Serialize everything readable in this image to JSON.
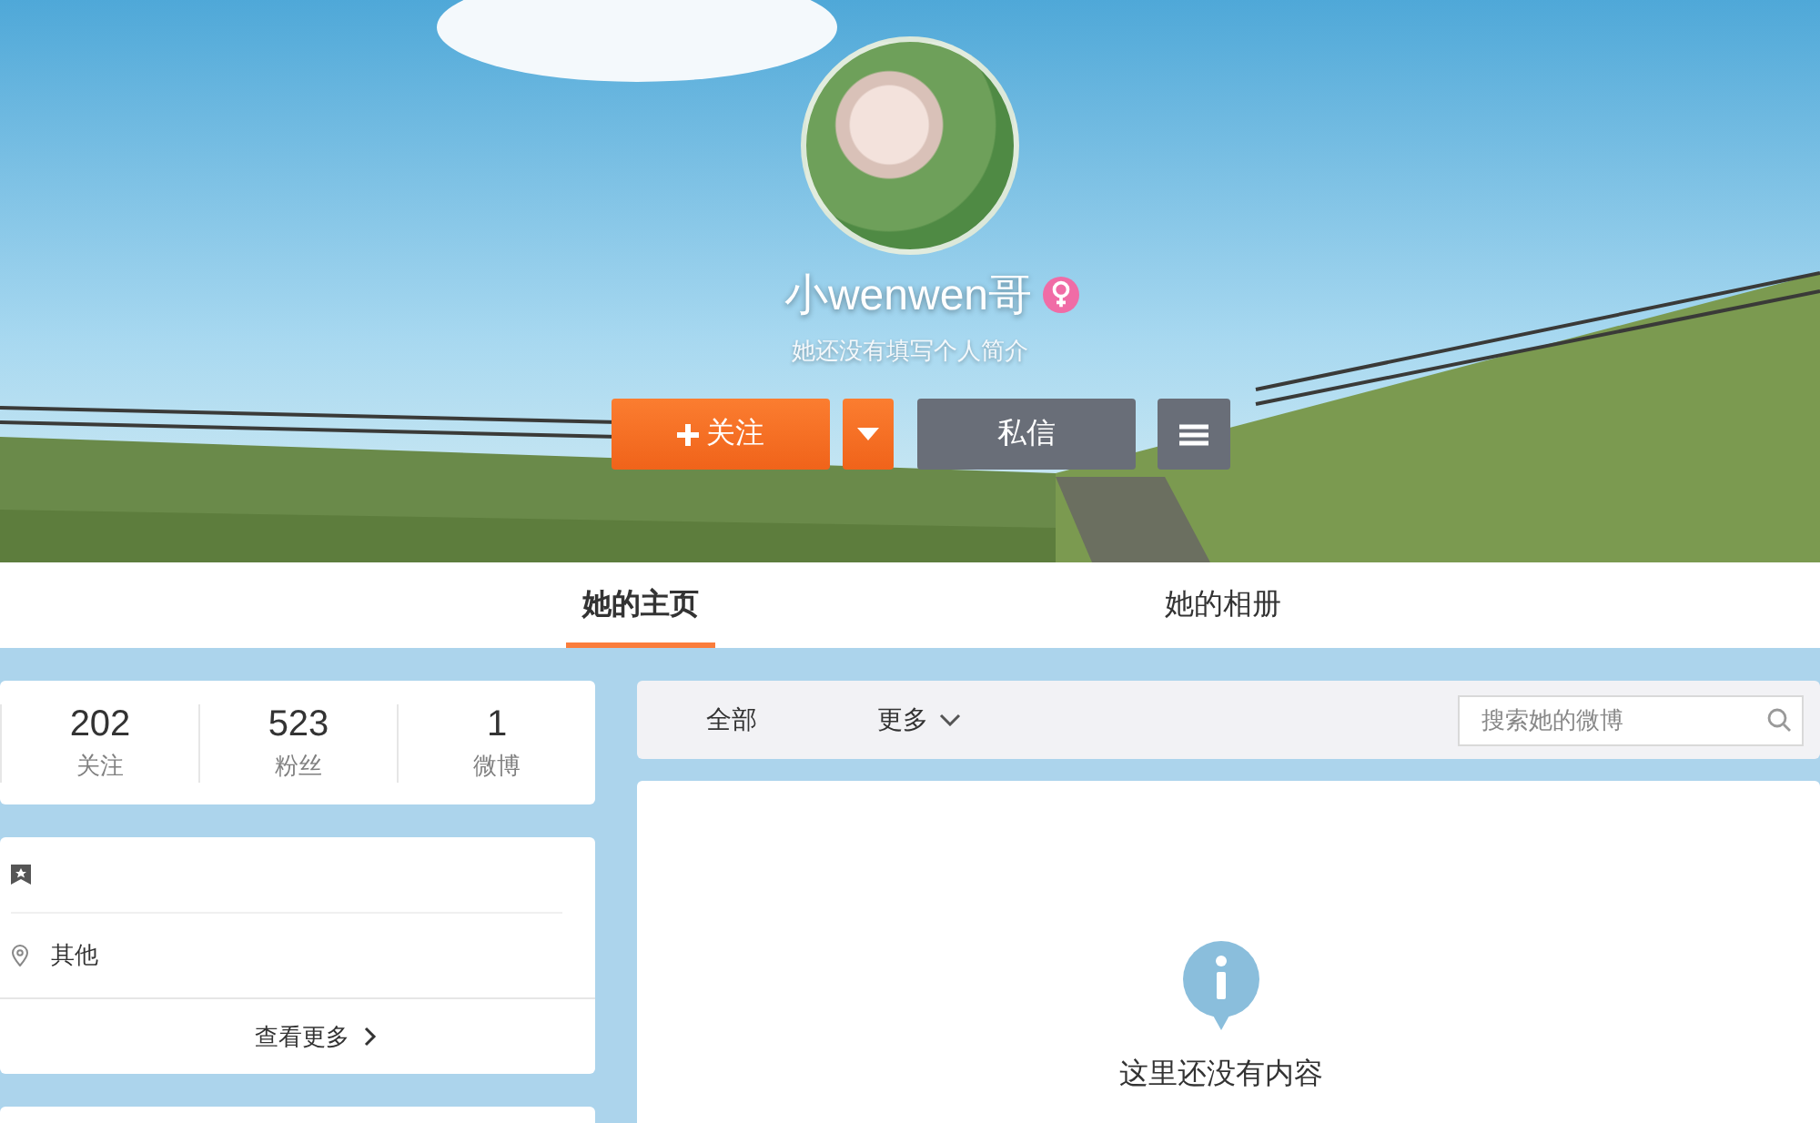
{
  "profile": {
    "name": "小wenwen哥",
    "female": true,
    "bio": "她还没有填写个人简介"
  },
  "actions": {
    "follow": "关注",
    "message": "私信"
  },
  "tabs": [
    {
      "label": "她的主页",
      "selected": true
    },
    {
      "label": "她的相册",
      "selected": false
    }
  ],
  "stats": [
    {
      "value": "202",
      "label": "关注"
    },
    {
      "value": "523",
      "label": "粉丝"
    },
    {
      "value": "1",
      "label": "微博"
    }
  ],
  "info": {
    "location": "其他",
    "more": "查看更多"
  },
  "feed": {
    "filters": [
      {
        "label": "全部",
        "dropdown": false
      },
      {
        "label": "更多",
        "dropdown": true
      }
    ],
    "search_placeholder": "搜索她的微博",
    "empty_message": "这里还没有内容"
  }
}
